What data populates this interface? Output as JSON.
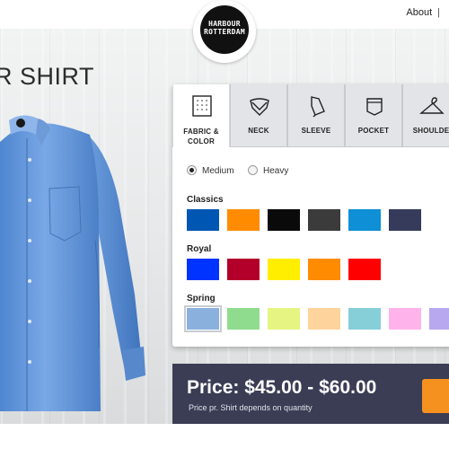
{
  "nav": {
    "about": "About",
    "separator": "|"
  },
  "logo": {
    "line1": "HARBOUR",
    "line2": "ROTTERDAM"
  },
  "heading": "R SHIRT",
  "tabs": [
    {
      "label_line1": "FABRIC &",
      "label_line2": "COLOR",
      "icon": "fabric-icon",
      "active": true
    },
    {
      "label_line1": "NECK",
      "icon": "collar-icon"
    },
    {
      "label_line1": "SLEEVE",
      "icon": "sleeve-icon"
    },
    {
      "label_line1": "POCKET",
      "icon": "pocket-icon"
    },
    {
      "label_line1": "SHOULDE",
      "icon": "hanger-icon"
    }
  ],
  "fabric_weight": {
    "options": [
      {
        "label": "Medium",
        "selected": true
      },
      {
        "label": "Heavy",
        "selected": false
      }
    ]
  },
  "color_groups": [
    {
      "title": "Classics",
      "colors": [
        "#0056b3",
        "#ff8c00",
        "#0a0a0a",
        "#3b3b3b",
        "#0f8fd6",
        "#363b5c"
      ]
    },
    {
      "title": "Royal",
      "colors": [
        "#0033ff",
        "#b3002a",
        "#ffee00",
        "#ff8c00",
        "#ff0000"
      ]
    },
    {
      "title": "Spring",
      "colors": [
        "#8ab0de",
        "#8fdc8f",
        "#e6f582",
        "#ffd39c",
        "#86cfd8",
        "#ffb3ea",
        "#b8a8f0"
      ]
    }
  ],
  "price": {
    "text": "Price: $45.00 - $60.00",
    "note": "Price pr. Shirt depends on quantity"
  },
  "colors": {
    "accent": "#f5911e",
    "price_bar": "#3a3d54"
  }
}
